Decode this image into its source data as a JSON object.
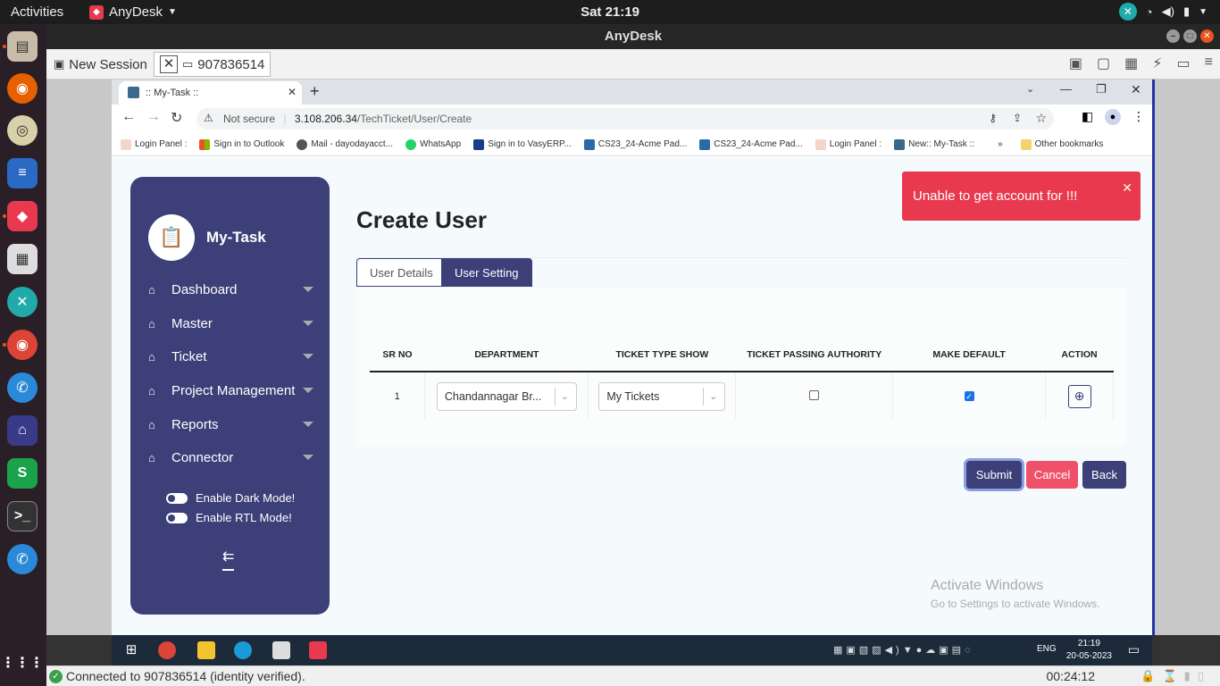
{
  "ubuntu": {
    "activities": "Activities",
    "app_name": "AnyDesk",
    "clock": "Sat 21:19"
  },
  "anydesk": {
    "window_title": "AnyDesk",
    "tab_new_session": "New Session",
    "tab_remote": "907836514",
    "status": "Connected to 907836514 (identity verified).",
    "timer": "00:24:12"
  },
  "chrome": {
    "tab_title": ":: My-Task ::",
    "not_secure": "Not secure",
    "url_host": "3.108.206.34",
    "url_path": "/TechTicket/User/Create",
    "bookmarks": [
      "Login Panel :",
      "Sign in to Outlook",
      "Mail - dayodayacct...",
      "WhatsApp",
      "Sign in to VasyERP...",
      "CS23_24-Acme Pad...",
      "CS23_24-Acme Pad...",
      "Login Panel :",
      "New:: My-Task ::"
    ],
    "other_bookmarks": "Other bookmarks"
  },
  "sidebar": {
    "brand": "My-Task",
    "menu": [
      "Dashboard",
      "Master",
      "Ticket",
      "Project Management",
      "Reports",
      "Connector"
    ],
    "dark_mode": "Enable Dark Mode!",
    "rtl_mode": "Enable RTL Mode!"
  },
  "main": {
    "title": "Create User",
    "tabs": [
      "User Details",
      "User Setting"
    ],
    "active_tab": "User Setting",
    "columns": [
      "SR NO",
      "DEPARTMENT",
      "TICKET TYPE SHOW",
      "TICKET PASSING AUTHORITY",
      "MAKE DEFAULT",
      "ACTION"
    ],
    "row": {
      "sr_no": "1",
      "department": "Chandannagar Br...",
      "ticket_type": "My Tickets",
      "passing_authority": false,
      "make_default": true
    },
    "buttons": {
      "submit": "Submit",
      "cancel": "Cancel",
      "back": "Back"
    }
  },
  "toast": {
    "message": "Unable to get account for !!!"
  },
  "watermark": {
    "line1": "Activate Windows",
    "line2": "Go to Settings to activate Windows."
  },
  "windows_taskbar": {
    "time": "21:19",
    "date": "20-05-2023",
    "lang": "ENG"
  },
  "colors": {
    "sidebar": "#3c3f78",
    "toast": "#e8394f",
    "cancel": "#f0506a",
    "submit": "#3c3f78"
  }
}
